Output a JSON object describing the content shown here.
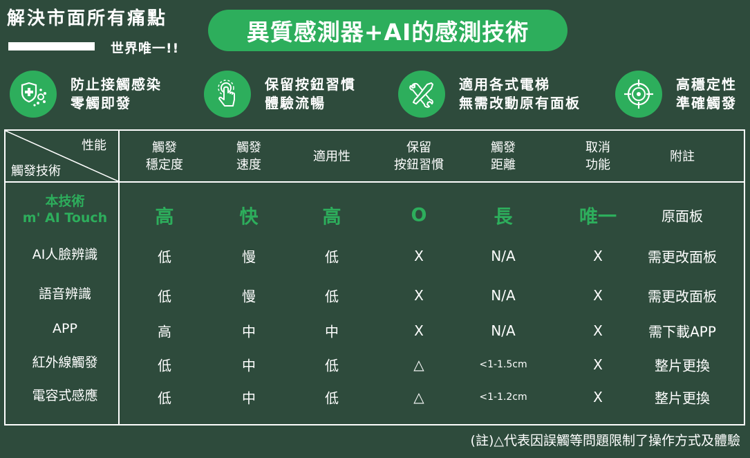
{
  "header": {
    "headline": "解決市面所有痛點",
    "sub_headline": "世界唯一!!",
    "pill_title": "異質感測器+AI的感測技術"
  },
  "features": [
    {
      "icon": "shield-virus-icon",
      "line1": "防止接觸感染",
      "line2": "零觸即發"
    },
    {
      "icon": "finger-press-icon",
      "line1": "保留按鈕習慣",
      "line2": "體驗流暢"
    },
    {
      "icon": "wrench-screwdriver-icon",
      "line1": "適用各式電梯",
      "line2": "無需改動原有面板"
    },
    {
      "icon": "crosshair-target-icon",
      "line1": "高穩定性",
      "line2": "準確觸發"
    }
  ],
  "table": {
    "corner_top": "性能",
    "corner_bottom": "觸發技術",
    "columns": [
      {
        "line1": "觸發",
        "line2": "穩定度"
      },
      {
        "line1": "觸發",
        "line2": "速度"
      },
      {
        "line1": "適用性",
        "line2": ""
      },
      {
        "line1": "保留",
        "line2": "按鈕習慣"
      },
      {
        "line1": "觸發",
        "line2": "距離"
      },
      {
        "line1": "取消",
        "line2": "功能"
      },
      {
        "line1": "附註",
        "line2": ""
      }
    ],
    "rows": [
      {
        "label1": "本技術",
        "label2": "m' AI Touch",
        "highlight": true,
        "cells": [
          "高",
          "快",
          "高",
          "O",
          "長",
          "唯一",
          "原面板"
        ]
      },
      {
        "label1": "AI人臉辨識",
        "label2": "",
        "cells": [
          "低",
          "慢",
          "低",
          "X",
          "N/A",
          "X",
          "需更改面板"
        ]
      },
      {
        "label1": "語音辨識",
        "label2": "",
        "cells": [
          "低",
          "慢",
          "低",
          "X",
          "N/A",
          "X",
          "需更改面板"
        ]
      },
      {
        "label1": "APP",
        "label2": "",
        "cells": [
          "高",
          "中",
          "中",
          "X",
          "N/A",
          "X",
          "需下載APP"
        ]
      },
      {
        "label1": "紅外線觸發",
        "label2": "",
        "cells": [
          "低",
          "中",
          "低",
          "△",
          "<1-1.5cm",
          "X",
          "整片更換"
        ]
      },
      {
        "label1": "電容式感應",
        "label2": "",
        "cells": [
          "低",
          "中",
          "低",
          "△",
          "<1-1.2cm",
          "X",
          "整片更換"
        ]
      }
    ]
  },
  "footnote": "(註)△代表因誤觸等問題限制了操作方式及體驗",
  "colors": {
    "background": "#2e4b3c",
    "accent": "#2dae5c",
    "text": "#ffffff"
  }
}
